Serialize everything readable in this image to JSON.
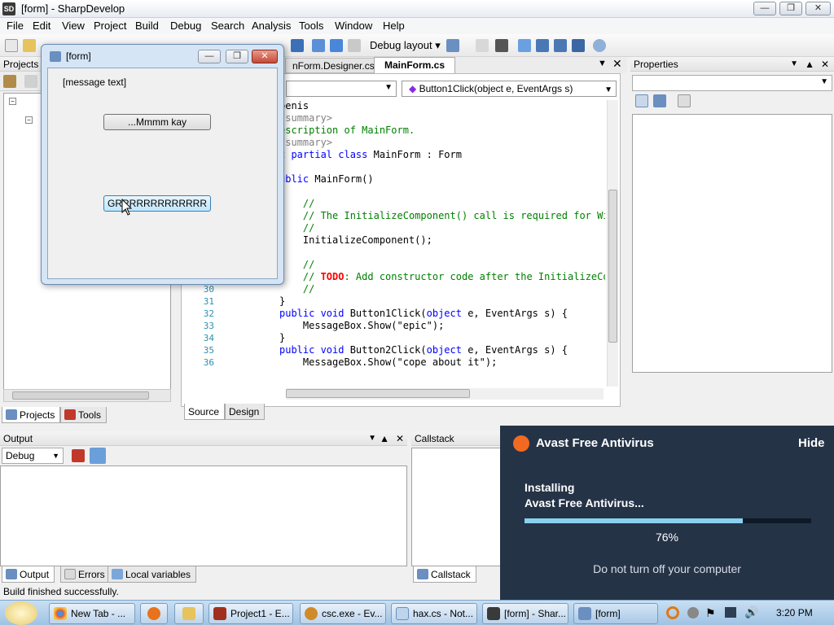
{
  "window": {
    "title": "[form] - SharpDevelop",
    "app_icon": "SD"
  },
  "menu": [
    "File",
    "Edit",
    "View",
    "Project",
    "Build",
    "Debug",
    "Search",
    "Analysis",
    "Tools",
    "Window",
    "Help"
  ],
  "toolbar": {
    "layout_label": "Debug layout"
  },
  "projects_panel": {
    "title": "Projects",
    "tabs": [
      "Projects",
      "Tools"
    ]
  },
  "editor": {
    "tabs": [
      "nForm.Designer.cs",
      "MainForm.cs"
    ],
    "member_dropdown": "Button1Click(object e, EventArgs s)",
    "bottom_tabs": [
      "Source",
      "Design"
    ],
    "lines": [
      {
        "n": "",
        "segments": [
          {
            "t": "penis",
            "c": "ty"
          }
        ]
      },
      {
        "n": "",
        "segments": [
          {
            "t": "/summary>",
            "c": "xml"
          }
        ]
      },
      {
        "n": "",
        "segments": [
          {
            "t": "escription of MainForm.",
            "c": "cm"
          }
        ]
      },
      {
        "n": "",
        "segments": [
          {
            "t": "/summary>",
            "c": "xml"
          }
        ]
      },
      {
        "n": "",
        "segments": [
          {
            "t": "c ",
            "c": "kw"
          },
          {
            "t": "partial class ",
            "c": "kw"
          },
          {
            "t": "MainForm : Form",
            "c": "ty"
          }
        ]
      },
      {
        "n": "",
        "segments": [
          {
            "t": "",
            "c": "ty"
          }
        ]
      },
      {
        "n": "",
        "segments": [
          {
            "t": "ublic ",
            "c": "kw"
          },
          {
            "t": "MainForm()",
            "c": "ty"
          }
        ]
      },
      {
        "n": "",
        "segments": [
          {
            "t": "",
            "c": "ty"
          }
        ]
      },
      {
        "n": "",
        "segments": [
          {
            "t": "    //",
            "c": "cm"
          }
        ]
      },
      {
        "n": "",
        "segments": [
          {
            "t": "    // The InitializeComponent() call is required for Wir",
            "c": "cm"
          }
        ]
      },
      {
        "n": "",
        "segments": [
          {
            "t": "    //",
            "c": "cm"
          }
        ]
      },
      {
        "n": "",
        "segments": [
          {
            "t": "    InitializeComponent();",
            "c": "ty"
          }
        ]
      },
      {
        "n": "",
        "segments": [
          {
            "t": "",
            "c": "ty"
          }
        ]
      },
      {
        "n": "",
        "segments": [
          {
            "t": "    //",
            "c": "cm"
          }
        ]
      },
      {
        "n": "29",
        "segments": [
          {
            "t": "    // ",
            "c": "cm"
          },
          {
            "t": "TODO",
            "c": "todo"
          },
          {
            "t": ": Add constructor code after the InitializeCom",
            "c": "cm"
          }
        ]
      },
      {
        "n": "30",
        "segments": [
          {
            "t": "    //",
            "c": "cm"
          }
        ]
      },
      {
        "n": "31",
        "segments": [
          {
            "t": "}",
            "c": "ty"
          }
        ]
      },
      {
        "n": "32",
        "segments": [
          {
            "t": "public void ",
            "c": "kw"
          },
          {
            "t": "Button1Click(",
            "c": "ty"
          },
          {
            "t": "object ",
            "c": "kw"
          },
          {
            "t": "e, EventArgs s) {",
            "c": "ty"
          }
        ]
      },
      {
        "n": "33",
        "segments": [
          {
            "t": "    MessageBox.Show(\"epic\");",
            "c": "ty"
          }
        ]
      },
      {
        "n": "34",
        "segments": [
          {
            "t": "}",
            "c": "ty"
          }
        ]
      },
      {
        "n": "35",
        "segments": [
          {
            "t": "public void ",
            "c": "kw"
          },
          {
            "t": "Button2Click(",
            "c": "ty"
          },
          {
            "t": "object ",
            "c": "kw"
          },
          {
            "t": "e, EventArgs s) {",
            "c": "ty"
          }
        ]
      },
      {
        "n": "36",
        "segments": [
          {
            "t": "    MessageBox.Show(\"cope about it\");",
            "c": "ty"
          }
        ]
      }
    ]
  },
  "properties_panel": {
    "title": "Properties"
  },
  "output_panel": {
    "title": "Output",
    "source": "Debug",
    "tabs": [
      "Output",
      "Errors",
      "Local variables"
    ]
  },
  "callstack_panel": {
    "title": "Callstack",
    "tab": "Callstack"
  },
  "status": "Build finished successfully.",
  "dialog": {
    "title": "[form]",
    "message": "[message text]",
    "button1": "...Mmmm kay",
    "button2": "GRRRRRRRRRRRRR"
  },
  "avast": {
    "title": "Avast Free Antivirus",
    "hide": "Hide",
    "line1": "Installing",
    "line2": "Avast Free Antivirus...",
    "progress_percent": 76,
    "progress_text": "76%",
    "warning": "Do not turn off your computer",
    "accent": "#f26a21"
  },
  "taskbar": {
    "items": [
      "New Tab - ...",
      "",
      "",
      "Project1 - E...",
      "csc.exe - Ev...",
      "hax.cs - Not...",
      "[form] - Shar...",
      "[form]"
    ],
    "clock": "3:20 PM"
  }
}
